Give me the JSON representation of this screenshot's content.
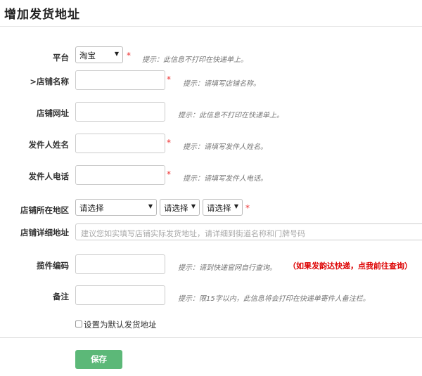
{
  "page": {
    "title": "增加发货地址"
  },
  "form": {
    "platform": {
      "label": "平台",
      "value": "淘宝",
      "required": "*",
      "hint": "提示：此信息不打印在快递单上。"
    },
    "shop_name": {
      "label": ">店铺名称",
      "value": "",
      "required": "*",
      "hint": "提示：请填写店铺名称。"
    },
    "shop_url": {
      "label": "店铺网址",
      "value": "",
      "hint": "提示：此信息不打印在快递单上。"
    },
    "sender_name": {
      "label": "发件人姓名",
      "value": "",
      "required": "*",
      "hint": "提示：请填写发件人姓名。"
    },
    "sender_phone": {
      "label": "发件人电话",
      "value": "",
      "required": "*",
      "hint": "提示：请填写发件人电话。"
    },
    "region": {
      "label": "店铺所在地区",
      "province": "请选择",
      "city": "请选择",
      "district": "请选择",
      "required": "*"
    },
    "address": {
      "label": "店铺详细地址",
      "placeholder": "建议您如实填写店铺实际发货地址，请详细到街道名称和门牌号码"
    },
    "pickup_code": {
      "label": "揽件编码",
      "value": "",
      "hint": "提示：请到快递官网自行查询。",
      "link": "（如果发韵达快递，点我前往查询）"
    },
    "remark": {
      "label": "备注",
      "value": "",
      "hint": "提示：限15字以内，此信息将会打印在快递单寄件人备注栏。"
    },
    "default_checkbox": {
      "label": "设置为默认发货地址",
      "checked": false
    }
  },
  "actions": {
    "save_label": "保存"
  },
  "colors": {
    "required": "#e33",
    "link": "#d00",
    "save_button": "#5cb878"
  }
}
